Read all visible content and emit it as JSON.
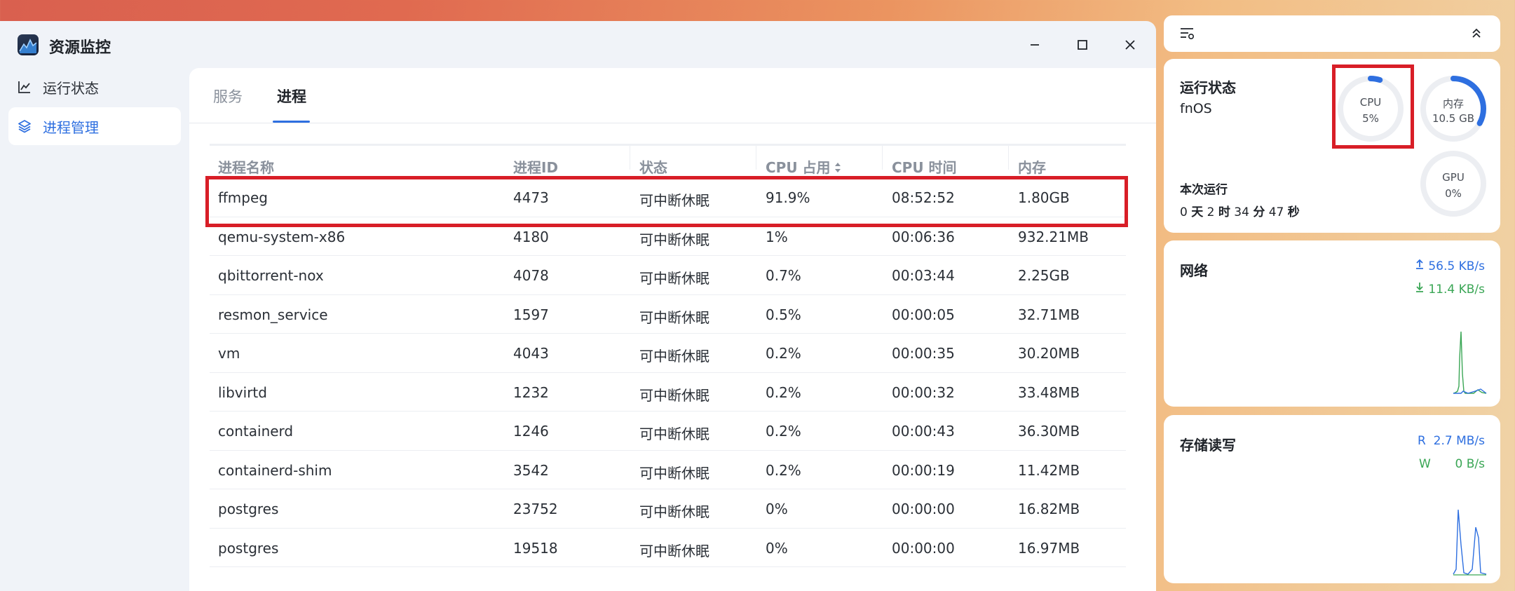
{
  "app": {
    "title": "资源监控"
  },
  "sidebar": {
    "items": [
      {
        "label": "运行状态",
        "icon": "line-chart-icon",
        "active": false
      },
      {
        "label": "进程管理",
        "icon": "layers-icon",
        "active": true
      }
    ]
  },
  "tabs": [
    {
      "label": "服务",
      "active": false
    },
    {
      "label": "进程",
      "active": true
    }
  ],
  "table": {
    "headers": {
      "name": "进程名称",
      "pid": "进程ID",
      "status": "状态",
      "cpu": "CPU 占用",
      "cpu_time": "CPU 时间",
      "memory": "内存"
    },
    "rows": [
      {
        "name": "ffmpeg",
        "pid": "4473",
        "status": "可中断休眠",
        "cpu": "91.9%",
        "cpu_time": "08:52:52",
        "memory": "1.80GB"
      },
      {
        "name": "qemu-system-x86",
        "pid": "4180",
        "status": "可中断休眠",
        "cpu": "1%",
        "cpu_time": "00:06:36",
        "memory": "932.21MB"
      },
      {
        "name": "qbittorrent-nox",
        "pid": "4078",
        "status": "可中断休眠",
        "cpu": "0.7%",
        "cpu_time": "00:03:44",
        "memory": "2.25GB"
      },
      {
        "name": "resmon_service",
        "pid": "1597",
        "status": "可中断休眠",
        "cpu": "0.5%",
        "cpu_time": "00:00:05",
        "memory": "32.71MB"
      },
      {
        "name": "vm",
        "pid": "4043",
        "status": "可中断休眠",
        "cpu": "0.2%",
        "cpu_time": "00:00:35",
        "memory": "30.20MB"
      },
      {
        "name": "libvirtd",
        "pid": "1232",
        "status": "可中断休眠",
        "cpu": "0.2%",
        "cpu_time": "00:00:32",
        "memory": "33.48MB"
      },
      {
        "name": "containerd",
        "pid": "1246",
        "status": "可中断休眠",
        "cpu": "0.2%",
        "cpu_time": "00:00:43",
        "memory": "36.30MB"
      },
      {
        "name": "containerd-shim",
        "pid": "3542",
        "status": "可中断休眠",
        "cpu": "0.2%",
        "cpu_time": "00:00:19",
        "memory": "11.42MB"
      },
      {
        "name": "postgres",
        "pid": "23752",
        "status": "可中断休眠",
        "cpu": "0%",
        "cpu_time": "00:00:00",
        "memory": "16.82MB"
      },
      {
        "name": "postgres",
        "pid": "19518",
        "status": "可中断休眠",
        "cpu": "0%",
        "cpu_time": "00:00:00",
        "memory": "16.97MB"
      }
    ]
  },
  "widgets": {
    "status": {
      "title": "运行状态",
      "os": "fnOS",
      "uptime_label": "本次运行",
      "uptime_parts": [
        "0",
        "天",
        "2",
        "时",
        "34",
        "分",
        "47",
        "秒"
      ],
      "cpu": {
        "label": "CPU",
        "value": "5%",
        "fraction": 0.05
      },
      "memory": {
        "label": "内存",
        "value": "10.5 GB",
        "fraction": 0.33
      },
      "gpu": {
        "label": "GPU",
        "value": "0%",
        "fraction": 0
      }
    },
    "network": {
      "title": "网络",
      "upload": "56.5 KB/s",
      "download": "11.4 KB/s"
    },
    "storage": {
      "title": "存储读写",
      "read_label": "R",
      "read": "2.7 MB/s",
      "write_label": "W",
      "write": "0 B/s"
    }
  },
  "colors": {
    "accent": "#2e6fe0",
    "highlight": "#d81e27",
    "download": "#3aa655",
    "upload": "#2e6fe0"
  }
}
